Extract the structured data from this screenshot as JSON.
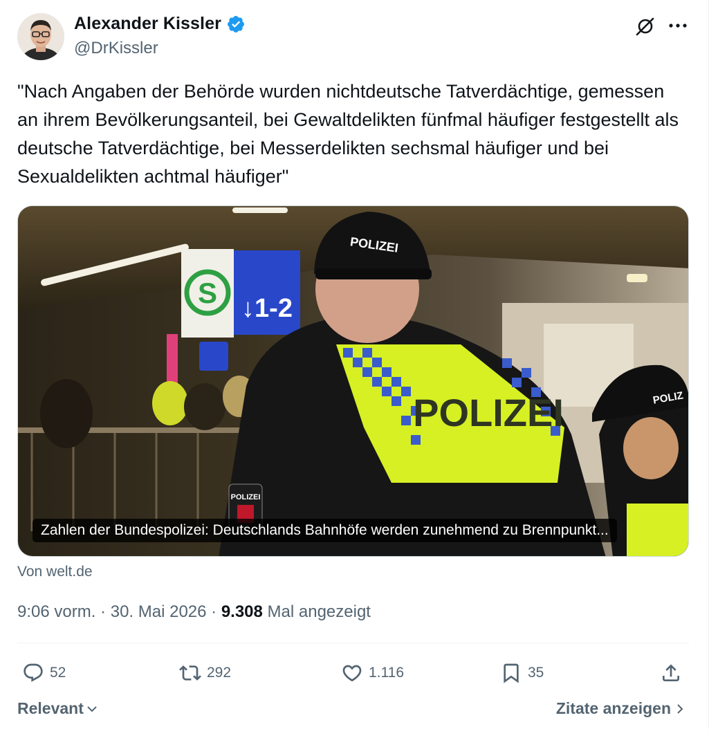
{
  "author": {
    "name": "Alexander Kissler",
    "handle": "@DrKissler",
    "verified_color": "#1d9bf0"
  },
  "tweet": {
    "text": "\"Nach Angaben der Behörde wurden nichtdeutsche Tatverdächtige, gemessen an ihrem Bevölkerungsanteil, bei Gewaltdelikten fünfmal häufiger festgestellt als deutsche Tatverdächtige, bei Messerdelikten sechsmal häufiger und bei Sexualdelikten achtmal häufiger\""
  },
  "card": {
    "caption": "Zahlen der Bundespolizei: Deutschlands Bahnhöfe werden zunehmend zu Brennpunkt...",
    "source": "Von welt.de",
    "image": {
      "vest_text": "POLIZEI",
      "cap_text": "POLIZEI",
      "cap_text_2": "POLIZ",
      "sign_letter": "S",
      "sign_platform": "↓1-2",
      "patch_text": "POLIZEI"
    }
  },
  "meta": {
    "time": "9:06 vorm.",
    "separator_1": " · ",
    "date": "30. Mai 2026",
    "separator_2": " · ",
    "views_count": "9.308",
    "views_label": " Mal angezeigt"
  },
  "actions": {
    "replies": "52",
    "reposts": "292",
    "likes": "1.116",
    "bookmarks": "35"
  },
  "footer": {
    "sort_label": "Relevant",
    "quotes_label": "Zitate anzeigen"
  },
  "colors": {
    "text_primary": "#0f1419",
    "text_secondary": "#536471",
    "border": "#cfd9de",
    "vest_yellow": "#d6f024",
    "checker_blue": "#3a5ccc",
    "sign_green": "#2ea043",
    "sign_blue": "#2947c9"
  }
}
